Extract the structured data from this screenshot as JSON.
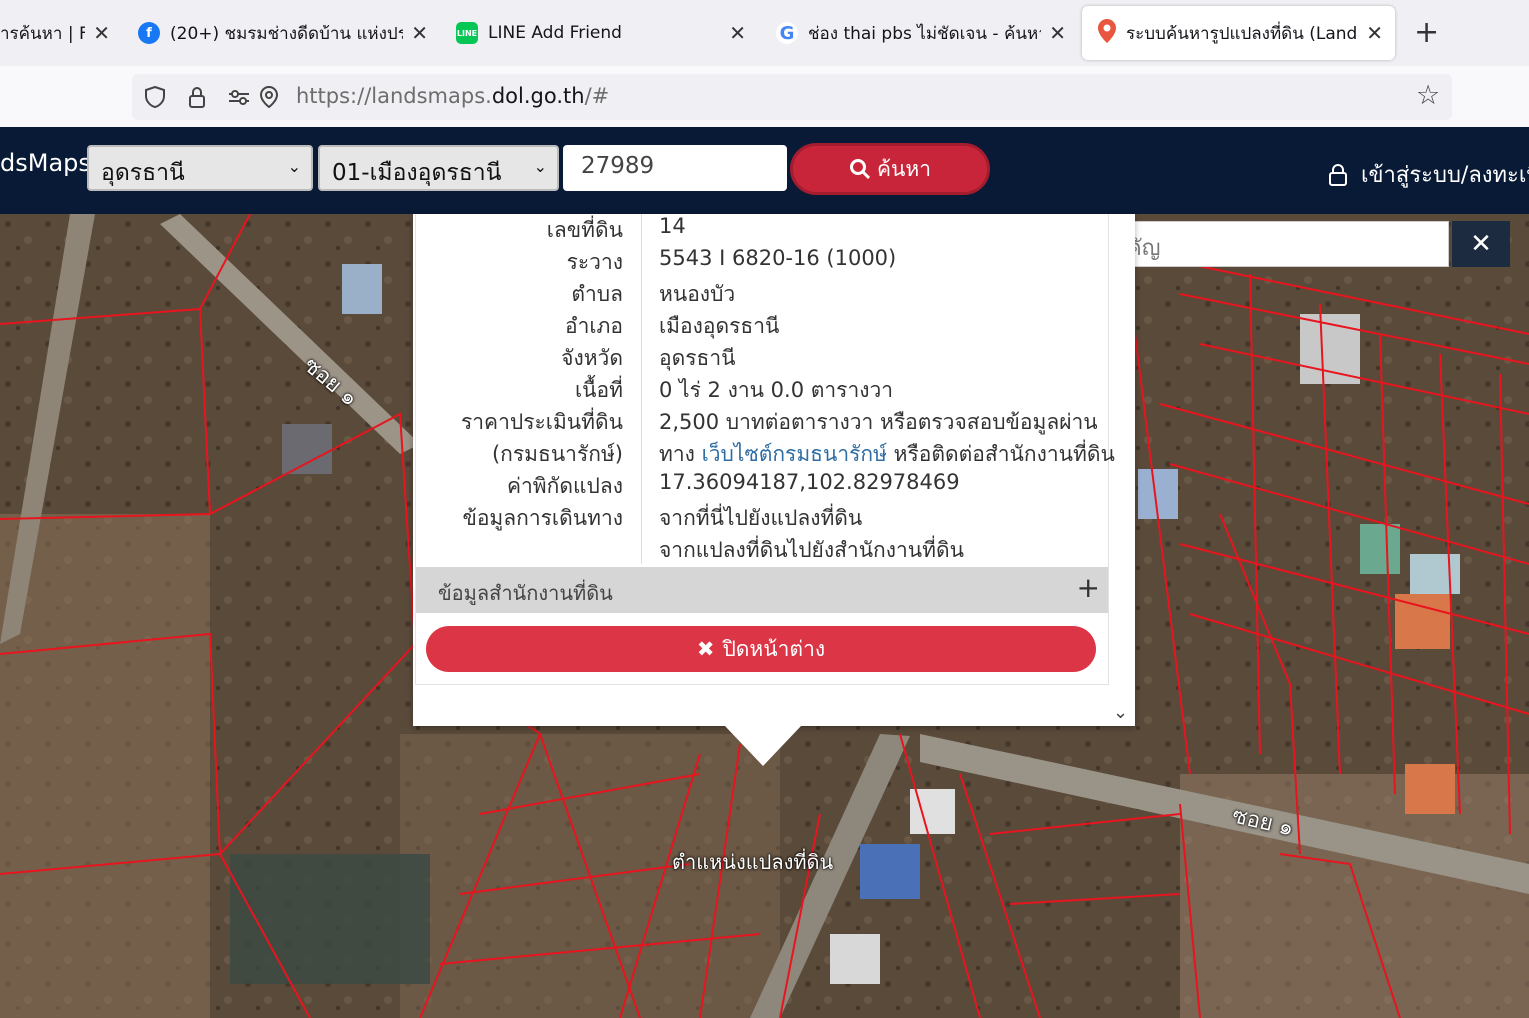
{
  "tabs": [
    {
      "title": "ารค้นหา | F",
      "favicon": "search-icon"
    },
    {
      "title": "(20+) ชมรมช่างดีดบ้าน แห่งประ",
      "favicon": "facebook-icon"
    },
    {
      "title": "LINE Add Friend",
      "favicon": "line-icon"
    },
    {
      "title": "ช่อง thai pbs ไม่ชัดเจน - ค้นหา",
      "favicon": "google-icon"
    },
    {
      "title": "ระบบค้นหารูปแปลงที่ดิน (Lands",
      "favicon": "location-pin-icon",
      "active": true
    }
  ],
  "url": {
    "prefix": "https://landsmaps.",
    "domain": "dol.go.th",
    "suffix": "/#"
  },
  "header": {
    "brand": "dsMaps",
    "province": "อุดรธานี",
    "district": "01-เมืองอุดรธานี",
    "parcel_number": "27989",
    "search_label": "ค้นหา",
    "login_label": "เข้าสู่ระบบ/ลงทะเบีย"
  },
  "place_search": {
    "placeholder": "ค้นหาสถานที่สำคัญ"
  },
  "parcel": {
    "rows": [
      {
        "label": "เลขที่ดิน",
        "value": "14"
      },
      {
        "label": "ระวาง",
        "value": "5543 I 6820-16 (1000)"
      },
      {
        "label": "ตำบล",
        "value": "หนองบัว"
      },
      {
        "label": "อำเภอ",
        "value": "เมืองอุดรธานี"
      },
      {
        "label": "จังหวัด",
        "value": "อุดรธานี"
      },
      {
        "label": "เนื้อที่",
        "value": "0 ไร่ 2 งาน 0.0 ตารางวา"
      },
      {
        "label": "ราคาประเมินที่ดิน",
        "value": "2,500 บาทต่อตารางวา หรือตรวจสอบข้อมูลผ่าน"
      },
      {
        "label": "(กรมธนารักษ์)",
        "value_prefix": "ทาง ",
        "link": "เว็บไซต์กรมธนารักษ์",
        "value_suffix": " หรือติดต่อสำนักงานที่ดิน"
      },
      {
        "label": "ค่าพิกัดแปลง",
        "link": "17.36094187,102.82978469"
      },
      {
        "label": "ข้อมูลการเดินทาง",
        "link": "จากที่นี่ไปยังแปลงที่ดิน"
      },
      {
        "label": "",
        "link": "จากแปลงที่ดินไปยังสำนักงานที่ดิน"
      }
    ],
    "office_section": "ข้อมูลสำนักงานที่ดิน",
    "close_label": "ปิดหน้าต่าง"
  },
  "map": {
    "labels": {
      "soi_left": "ซอย ๑",
      "soi_right": "ซอย ๑",
      "parcel_position": "ตำแหน่งแปลงที่ดิน"
    },
    "colors": {
      "boundary": "#e8141e"
    }
  },
  "colors": {
    "header_bg": "#081a35",
    "accent_red": "#dc3545",
    "link": "#2e6da4"
  }
}
